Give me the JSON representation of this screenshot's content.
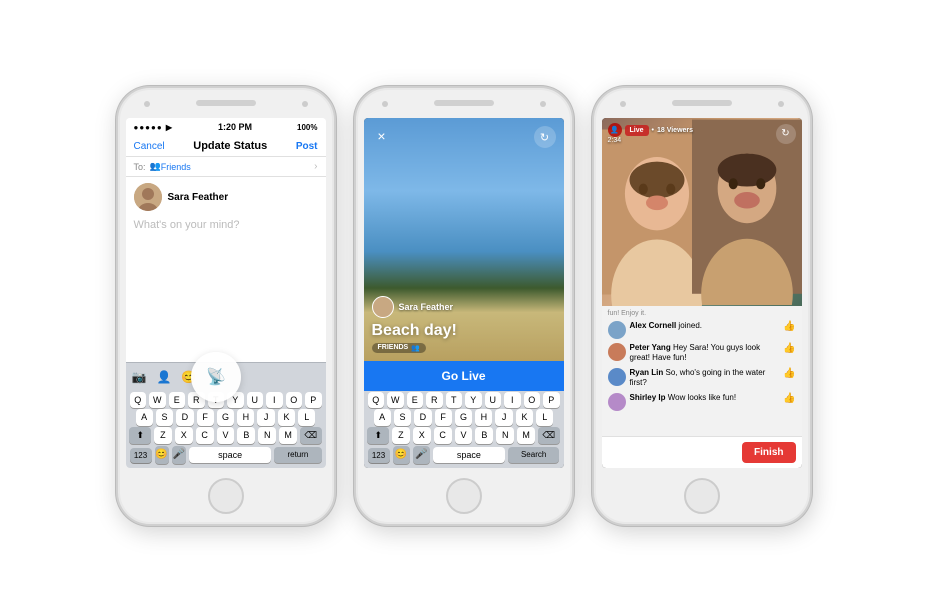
{
  "phones": [
    {
      "id": "phone1",
      "statusBar": {
        "signals": "●●●●● ▶",
        "time": "1:20 PM",
        "battery": "100%"
      },
      "navBar": {
        "cancel": "Cancel",
        "title": "Update Status",
        "post": "Post"
      },
      "toRow": {
        "label": "To:",
        "value": "Friends",
        "icon": "friends-icon"
      },
      "user": {
        "name": "Sara Feather",
        "avatarBg": "#c8a882"
      },
      "placeholder": "What's on your mind?",
      "toolbar": {
        "icons": [
          "camera-icon",
          "person-icon",
          "emoji-icon",
          "live-icon"
        ]
      },
      "keyboard": {
        "rows": [
          [
            "Q",
            "W",
            "E",
            "R",
            "T",
            "Y",
            "U",
            "I",
            "O",
            "P"
          ],
          [
            "A",
            "S",
            "D",
            "F",
            "G",
            "H",
            "J",
            "K",
            "L"
          ],
          [
            "⬆",
            "Z",
            "X",
            "C",
            "V",
            "B",
            "N",
            "M",
            "⌫"
          ],
          [
            "123",
            "😊",
            "🎤",
            "space",
            "return"
          ]
        ]
      }
    },
    {
      "id": "phone2",
      "beachTitle": "Beach day!",
      "friendsBadge": "FRIENDS",
      "userName": "Sara Feather",
      "closeIcon": "×",
      "refreshIcon": "↻",
      "goLiveLabel": "Go Live",
      "keyboard": {
        "rows": [
          [
            "Q",
            "W",
            "E",
            "R",
            "T",
            "Y",
            "U",
            "I",
            "O",
            "P"
          ],
          [
            "A",
            "S",
            "D",
            "F",
            "G",
            "H",
            "J",
            "K",
            "L"
          ],
          [
            "⬆",
            "Z",
            "X",
            "C",
            "V",
            "B",
            "N",
            "M",
            "⌫"
          ],
          [
            "123",
            "😊",
            "🎤",
            "space",
            "Search"
          ]
        ]
      }
    },
    {
      "id": "phone3",
      "liveBadge": "Live",
      "viewers": "18 Viewers",
      "timer": "2:34",
      "flipIcon": "↻",
      "funText": "fun! Enjoy it.",
      "comments": [
        {
          "name": "Alex Cornell",
          "text": " joined.",
          "avatarBg": "#7ba3c8",
          "hasLike": false
        },
        {
          "name": "Peter Yang",
          "text": " Hey Sara! You guys look great! Have fun!",
          "avatarBg": "#c87b5a",
          "hasLike": true
        },
        {
          "name": "Ryan Lin",
          "text": " So, who's going in the water first?",
          "avatarBg": "#5a8ac8",
          "hasLike": false
        },
        {
          "name": "Shirley Ip",
          "text": " Wow looks like fun!",
          "avatarBg": "#b58ac8",
          "hasLike": false
        }
      ],
      "finishLabel": "Finish"
    }
  ]
}
